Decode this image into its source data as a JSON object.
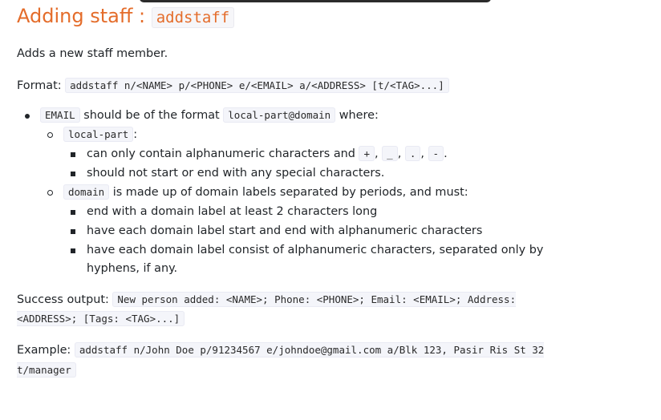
{
  "heading": {
    "text": "Adding staff :",
    "command": "addstaff"
  },
  "description": "Adds a new staff member.",
  "format": {
    "label": "Format:",
    "code": "addstaff n/<NAME> p/<PHONE> e/<EMAIL> a/<ADDRESS> [t/<TAG>...]"
  },
  "email_rule": {
    "code": "EMAIL",
    "text_before": "should be of the format",
    "format_code": "local-part@domain",
    "text_after": "where:",
    "local_part": {
      "code": "local-part",
      "suffix": ":",
      "rules": {
        "chars_text": "can only contain alphanumeric characters and",
        "chars": [
          "+",
          "_",
          ".",
          "-"
        ],
        "sep": ",",
        "end": ".",
        "no_special": "should not start or end with any special characters."
      }
    },
    "domain": {
      "code": "domain",
      "text": "is made up of domain labels separated by periods, and must:",
      "rules": [
        "end with a domain label at least 2 characters long",
        "have each domain label start and end with alphanumeric characters",
        "have each domain label consist of alphanumeric characters, separated only by hyphens, if any."
      ]
    }
  },
  "success": {
    "label": "Success output:",
    "code": "New person added: <NAME>; Phone: <PHONE>; Email: <EMAIL>; Address: <ADDRESS>; [Tags: <TAG>...]"
  },
  "example": {
    "label": "Example:",
    "code": "addstaff n/John Doe p/91234567 e/johndoe@gmail.com a/Blk 123, Pasir Ris St 32 t/manager"
  },
  "colors": {
    "heading": "#e46c2a",
    "code_bg": "#f4f5fa",
    "text": "#212529"
  }
}
